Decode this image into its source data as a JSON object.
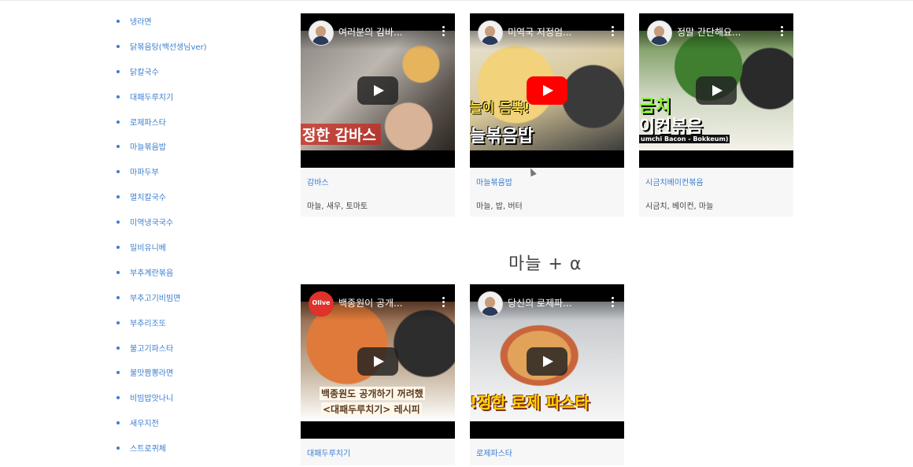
{
  "sidebar": {
    "items": [
      {
        "label": "냉라면"
      },
      {
        "label": "닭볶음탕(백선생님ver)"
      },
      {
        "label": "닭칼국수"
      },
      {
        "label": "대패두루치기"
      },
      {
        "label": "로제파스타"
      },
      {
        "label": "마늘볶음밥"
      },
      {
        "label": "마파두부"
      },
      {
        "label": "멸치칼국수"
      },
      {
        "label": "미역냉국국수"
      },
      {
        "label": "밀비유니베"
      },
      {
        "label": "부추계란볶음"
      },
      {
        "label": "부추고기비빔면"
      },
      {
        "label": "부추리조또"
      },
      {
        "label": "불고기파스타"
      },
      {
        "label": "불맛짬뽕라면"
      },
      {
        "label": "비빔밥앗나니"
      },
      {
        "label": "새우지전"
      },
      {
        "label": "스트로퀴체"
      }
    ]
  },
  "row1": {
    "cards": [
      {
        "video_title": "여러분의 감바...",
        "overlay": "정한 감바스",
        "link": "감바스",
        "tags": "마늘, 새우, 토마토"
      },
      {
        "video_title": "미역국 저정엄...",
        "overlay_top": "늘이 듬뿍!",
        "overlay": "늘볶음밥",
        "link": "마늘볶음밥",
        "tags": "마늘, 밥, 버터"
      },
      {
        "video_title": "정말 간단해요...",
        "overlay_top": "금치",
        "overlay": "이컨볶음",
        "overlay_small": "umchi Bacon - Bokkeum)",
        "link": "시금치베이컨볶음",
        "tags": "시금치, 베이컨, 마늘"
      }
    ]
  },
  "section": {
    "title": "마늘 + α"
  },
  "row2": {
    "cards": [
      {
        "video_title": "백종원이 공개...",
        "channel": "Olive",
        "overlay": "백종원도 공개하기 꺼려했",
        "overlay2": "<대패두루치기> 레시피",
        "link": "대패두루치기"
      },
      {
        "video_title": "당신의 로제파...",
        "overlay": "!정한 로제 파스타",
        "link": "로제파스타"
      }
    ]
  },
  "colors": {
    "link": "#3a7ecf",
    "youtube_red": "#ff0000",
    "card_bg": "#f7f7f8"
  }
}
